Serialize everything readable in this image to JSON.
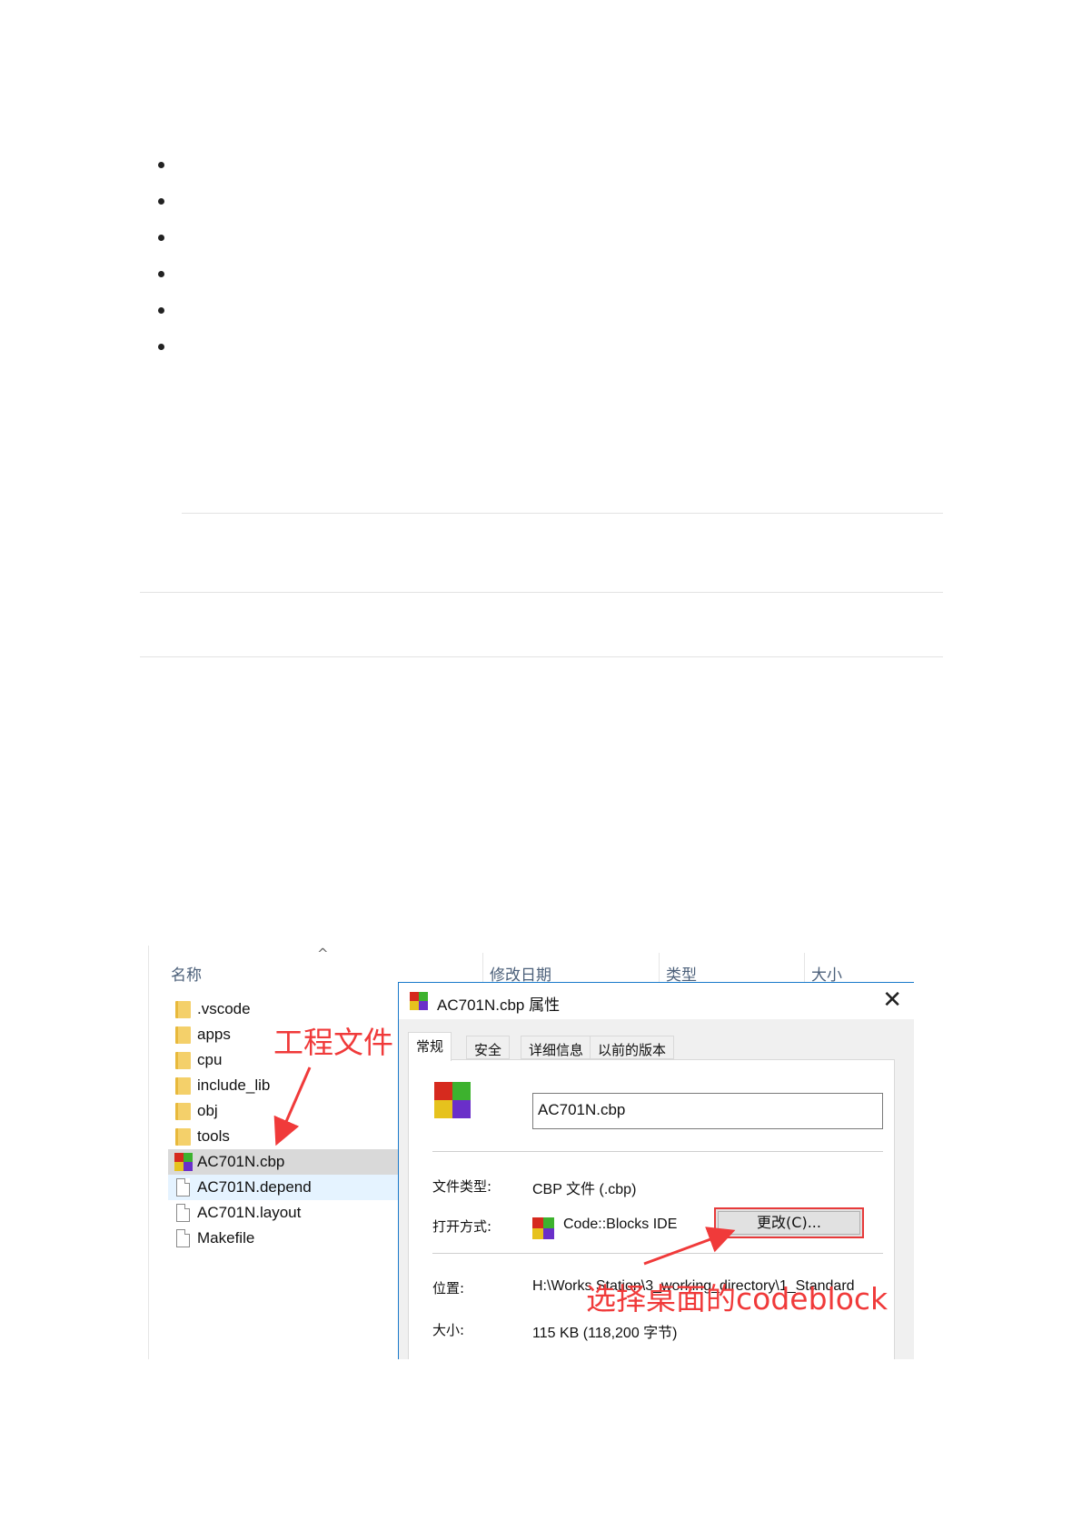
{
  "explorer": {
    "columns": {
      "name": "名称",
      "modified": "修改日期",
      "type": "类型",
      "size": "大小"
    },
    "sort_caret": "^",
    "files": [
      {
        "name": ".vscode",
        "icon": "folder-icon"
      },
      {
        "name": "apps",
        "icon": "folder-icon"
      },
      {
        "name": "cpu",
        "icon": "folder-icon"
      },
      {
        "name": "include_lib",
        "icon": "folder-icon"
      },
      {
        "name": "obj",
        "icon": "folder-icon"
      },
      {
        "name": "tools",
        "icon": "folder-icon"
      },
      {
        "name": "AC701N.cbp",
        "icon": "codeblocks-icon",
        "state": "selected"
      },
      {
        "name": "AC701N.depend",
        "icon": "document-icon",
        "state": "hover"
      },
      {
        "name": "AC701N.layout",
        "icon": "document-icon"
      },
      {
        "name": "Makefile",
        "icon": "document-icon"
      }
    ]
  },
  "dialog": {
    "title": "AC701N.cbp 属性",
    "close_glyph": "✕",
    "tabs": [
      "常规",
      "安全",
      "详细信息",
      "以前的版本"
    ],
    "active_tab": "常规",
    "filename": "AC701N.cbp",
    "file_type_label": "文件类型:",
    "file_type_value": "CBP 文件 (.cbp)",
    "open_with_label": "打开方式:",
    "open_with_value": "Code::Blocks IDE",
    "change_button": "更改(C)...",
    "location_label": "位置:",
    "location_value": "H:\\Works Station\\3_working_directory\\1_Standard",
    "size_label": "大小:",
    "size_value": "115 KB (118,200 字节)"
  },
  "annotations": {
    "project_file": "工程文件",
    "choose_codeblock": "选择桌面的codeblock",
    "color": "#f03a3a"
  }
}
